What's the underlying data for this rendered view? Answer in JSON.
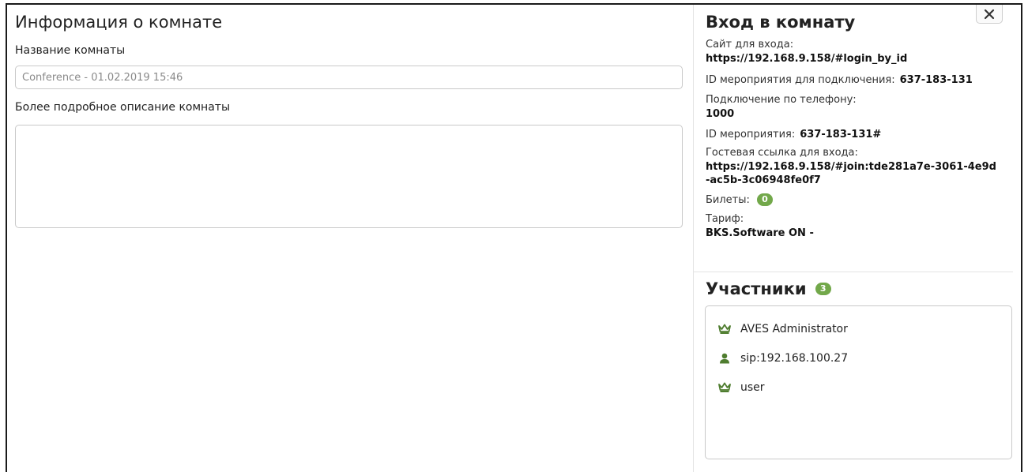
{
  "room_info": {
    "title": "Информация о комнате",
    "name_label": "Название комнаты",
    "name_value": "Conference - 01.02.2019 15:46",
    "description_label": "Более подробное описание комнаты",
    "description_value": ""
  },
  "entry": {
    "title": "Вход в комнату",
    "site_label": "Сайт для входа:",
    "site_value": "https://192.168.9.158/#login_by_id",
    "event_id_connect_label": "ID мероприятия для подключения:",
    "event_id_connect_value": "637-183-131",
    "phone_label": "Подключение по телефону:",
    "phone_value": "1000",
    "event_id_label": "ID мероприятия:",
    "event_id_value": "637-183-131#",
    "guest_link_label": "Гостевая ссылка для входа:",
    "guest_link_value": "https://192.168.9.158/#join:tde281a7e-3061-4e9d-ac5b-3c06948fe0f7",
    "tickets_label": "Билеты:",
    "tickets_count": "0",
    "tariff_label": "Тариф:",
    "tariff_value": "BKS.Software ON -"
  },
  "participants": {
    "title": "Участники",
    "count": "3",
    "items": [
      {
        "name": "AVES Administrator",
        "icon": "crown-icon"
      },
      {
        "name": "sip:192.168.100.27",
        "icon": "user-icon"
      },
      {
        "name": "user",
        "icon": "crown-icon"
      }
    ]
  },
  "close_label": "✕",
  "colors": {
    "accent": "#4f7d2f",
    "badge": "#72a84a"
  }
}
